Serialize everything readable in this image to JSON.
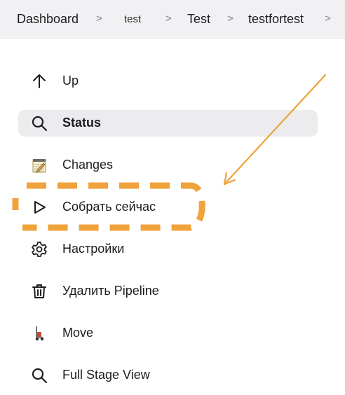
{
  "breadcrumb": {
    "items": [
      "Dashboard",
      "test",
      "Test",
      "testfortest"
    ],
    "separator": ">"
  },
  "sidebar": {
    "items": [
      {
        "label": "Up",
        "icon": "arrow-up-icon"
      },
      {
        "label": "Status",
        "icon": "search-icon"
      },
      {
        "label": "Changes",
        "icon": "notepad-icon"
      },
      {
        "label": "Собрать сейчас",
        "icon": "play-icon"
      },
      {
        "label": "Настройки",
        "icon": "gear-icon"
      },
      {
        "label": "Удалить Pipeline",
        "icon": "trash-icon"
      },
      {
        "label": "Move",
        "icon": "hand-truck-icon"
      },
      {
        "label": "Full Stage View",
        "icon": "search-icon"
      }
    ]
  },
  "annotation": {
    "color": "#f0a23b"
  },
  "colors": {
    "active_bg": "#ececee",
    "header_bg": "#f1f1f3"
  }
}
